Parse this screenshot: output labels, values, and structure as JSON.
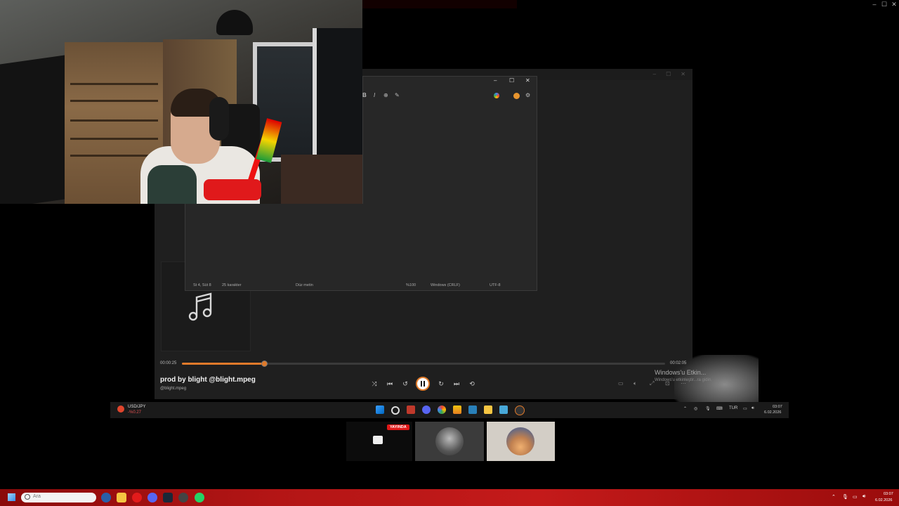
{
  "top_window_controls": [
    "–",
    "☐",
    "✕"
  ],
  "notepad": {
    "controls": [
      "–",
      "☐",
      "✕"
    ],
    "toolbar": [
      "B",
      "I",
      "⊕",
      "✎"
    ],
    "status": {
      "position": "St 4, Süt 8",
      "chars": "25 karakter",
      "format": "Düz metin",
      "zoom": "%100",
      "line_ending": "Windows (CRLF)",
      "encoding": "UTF-8"
    }
  },
  "player": {
    "time_current": "00:00:25",
    "time_total": "00:02:05",
    "progress": 0.17,
    "song_title": "prod by blight @blight.mpeg",
    "artist": "@blight.mpeg",
    "accent_color": "#e07a2a"
  },
  "watermark": {
    "title": "Windows'u Etkin...",
    "subtitle": "Windows'u etkinleştir...ra gidin."
  },
  "inner_taskbar": {
    "ticker_symbol": "USD/JPY",
    "ticker_change": "-%0.27",
    "lang": "TUR",
    "time": "03:07",
    "date": "6.02.2026"
  },
  "previews": {
    "badge": "YAYINDA"
  },
  "bottom_taskbar": {
    "search_placeholder": "Ara",
    "time": "03:07",
    "date": "6.02.2026"
  }
}
